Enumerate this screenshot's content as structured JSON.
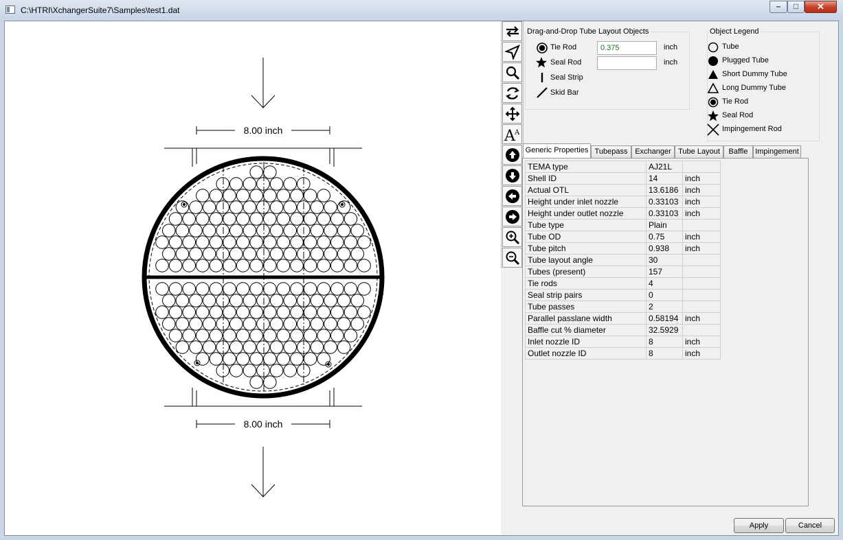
{
  "window": {
    "title": "C:\\HTRI\\XchangerSuite7\\Samples\\test1.dat"
  },
  "window_controls": {
    "minimize": "–",
    "maximize": "□",
    "close": "✕"
  },
  "drawing": {
    "top_dimension": "8.00 inch",
    "bottom_dimension": "8.00 inch"
  },
  "toolbar": {
    "tools": [
      {
        "name": "rotate-layout-icon"
      },
      {
        "name": "select-pointer-icon"
      },
      {
        "name": "magnifier-icon"
      },
      {
        "name": "refresh-icon"
      },
      {
        "name": "pan-move-icon"
      },
      {
        "name": "font-size-icon"
      },
      {
        "name": "arrow-up-icon"
      },
      {
        "name": "arrow-down-icon"
      },
      {
        "name": "arrow-left-icon"
      },
      {
        "name": "arrow-right-icon"
      },
      {
        "name": "zoom-in-icon"
      },
      {
        "name": "zoom-out-icon"
      }
    ]
  },
  "dragdrop": {
    "title": "Drag-and-Drop Tube Layout Objects",
    "tie_rod": {
      "label": "Tie Rod",
      "value": "0.375",
      "unit": "inch"
    },
    "seal_rod": {
      "label": "Seal Rod",
      "value": "",
      "unit": "inch"
    },
    "seal_strip": {
      "label": "Seal Strip"
    },
    "skid_bar": {
      "label": "Skid Bar"
    }
  },
  "legend": {
    "title": "Object Legend",
    "items": [
      {
        "label": "Tube",
        "icon": "open-circle-icon"
      },
      {
        "label": "Plugged Tube",
        "icon": "filled-circle-icon"
      },
      {
        "label": "Short Dummy Tube",
        "icon": "filled-triangle-icon"
      },
      {
        "label": "Long Dummy Tube",
        "icon": "open-triangle-icon"
      },
      {
        "label": "Tie Rod",
        "icon": "tie-rod-icon"
      },
      {
        "label": "Seal Rod",
        "icon": "star-icon"
      },
      {
        "label": "Impingement Rod",
        "icon": "cross-icon"
      }
    ]
  },
  "tabs": [
    {
      "label": "Generic Properties",
      "active": true
    },
    {
      "label": "Tubepass",
      "active": false
    },
    {
      "label": "Exchanger",
      "active": false
    },
    {
      "label": "Tube Layout",
      "active": false
    },
    {
      "label": "Baffle",
      "active": false
    },
    {
      "label": "Impingement",
      "active": false
    }
  ],
  "properties": [
    {
      "name": "TEMA type",
      "value": "AJ21L",
      "unit": ""
    },
    {
      "name": "Shell ID",
      "value": "14",
      "unit": "inch"
    },
    {
      "name": "Actual OTL",
      "value": "13.6186",
      "unit": "inch"
    },
    {
      "name": "Height under inlet nozzle",
      "value": "0.33103",
      "unit": "inch"
    },
    {
      "name": "Height under outlet nozzle",
      "value": "0.33103",
      "unit": "inch"
    },
    {
      "name": "Tube type",
      "value": "Plain",
      "unit": ""
    },
    {
      "name": "Tube OD",
      "value": "0.75",
      "unit": "inch"
    },
    {
      "name": "Tube pitch",
      "value": "0.938",
      "unit": "inch"
    },
    {
      "name": "Tube layout angle",
      "value": "30",
      "unit": ""
    },
    {
      "name": "Tubes (present)",
      "value": "157",
      "unit": ""
    },
    {
      "name": "Tie rods",
      "value": "4",
      "unit": ""
    },
    {
      "name": "Seal strip pairs",
      "value": "0",
      "unit": ""
    },
    {
      "name": "Tube passes",
      "value": "2",
      "unit": ""
    },
    {
      "name": "Parallel passlane width",
      "value": "0.58194",
      "unit": "inch"
    },
    {
      "name": "Baffle cut % diameter",
      "value": "32.5929",
      "unit": ""
    },
    {
      "name": "Inlet nozzle ID",
      "value": "8",
      "unit": "inch"
    },
    {
      "name": "Outlet nozzle ID",
      "value": "8",
      "unit": "inch"
    }
  ],
  "buttons": {
    "apply": "Apply",
    "cancel": "Cancel"
  }
}
